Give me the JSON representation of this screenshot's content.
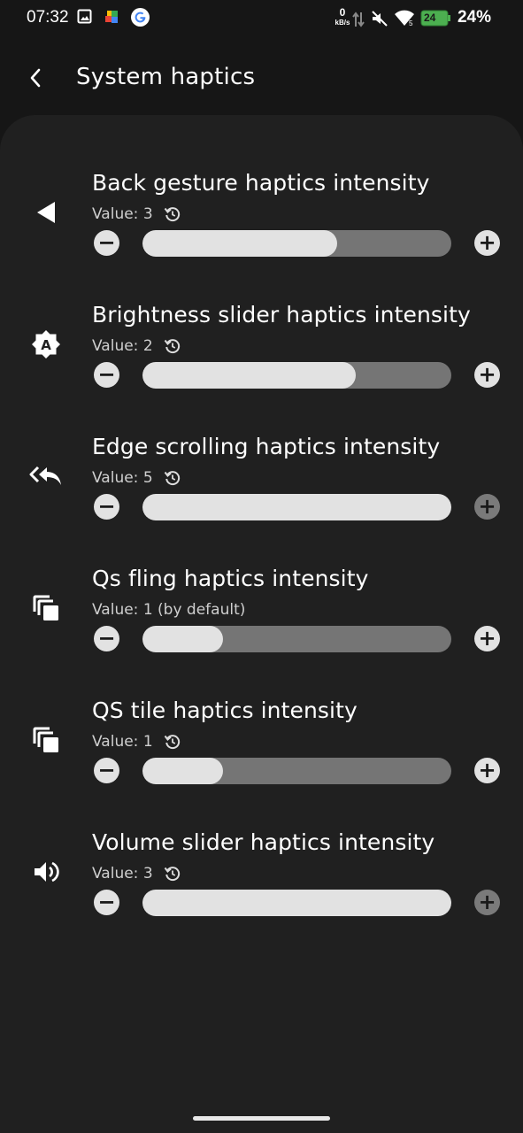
{
  "status_bar": {
    "time": "07:32",
    "net_speed_value": "0",
    "net_speed_unit": "kB/s",
    "battery_level": "24",
    "battery_percent": "24%",
    "signal_label": "5"
  },
  "header": {
    "title": "System haptics"
  },
  "items": [
    {
      "title": "Back gesture haptics intensity",
      "value": "Value: 3",
      "level": 0.63,
      "icon": "back-triangle-icon",
      "has_reset": true
    },
    {
      "title": "Brightness slider haptics intensity",
      "value": "Value: 2",
      "level": 0.69,
      "icon": "brightness-auto-icon",
      "has_reset": true
    },
    {
      "title": "Edge scrolling haptics intensity",
      "value": "Value: 5",
      "level": 1.0,
      "icon": "reply-all-icon",
      "has_reset": true
    },
    {
      "title": "Qs fling haptics intensity",
      "value": "Value: 1 (by default)",
      "level": 0.26,
      "icon": "copy-stack-icon",
      "has_reset": false
    },
    {
      "title": "QS tile haptics intensity",
      "value": "Value: 1",
      "level": 0.26,
      "icon": "copy-stack-icon",
      "has_reset": true
    },
    {
      "title": "Volume slider haptics intensity",
      "value": "Value: 3",
      "level": 1.0,
      "icon": "volume-icon",
      "has_reset": true
    }
  ],
  "colors": {
    "background": "#161616",
    "panel": "#202020",
    "track": "#757575",
    "fill": "#e2e2e2"
  }
}
